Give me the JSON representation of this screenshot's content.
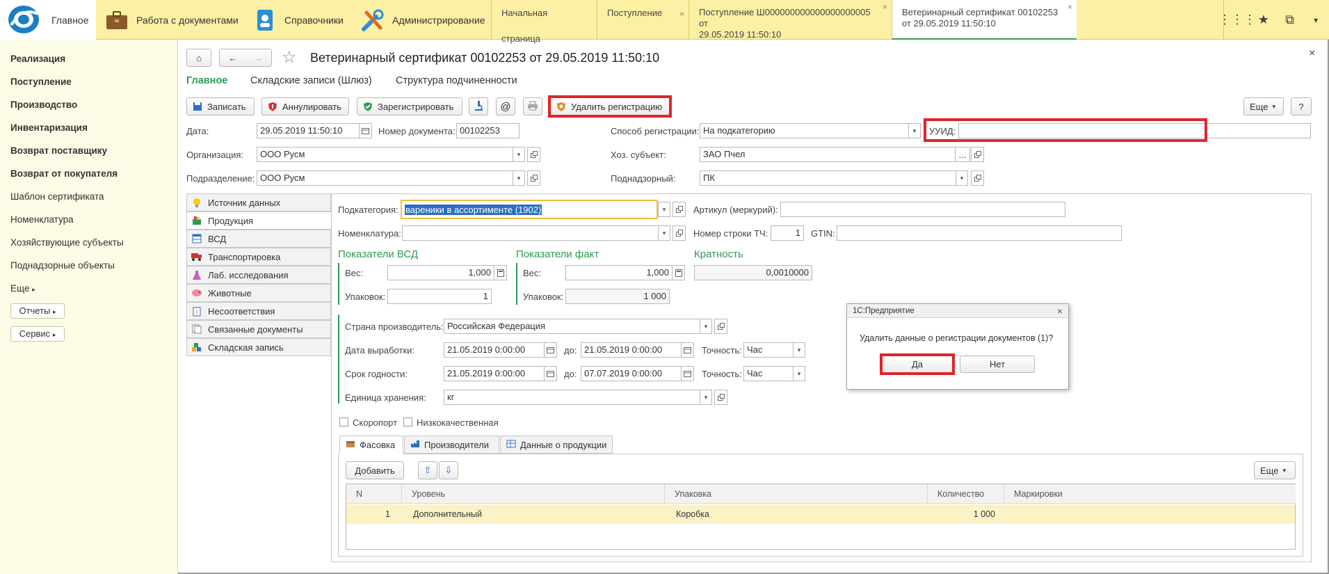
{
  "topbar": {
    "main_label": "Главное",
    "sections": [
      "Работа с документами",
      "Справочники",
      "Администрирование"
    ],
    "tabs": [
      {
        "label": "Начальная страница"
      },
      {
        "label": "Поступление"
      },
      {
        "label1": "Поступление Ш000000000000000000005 от",
        "label2": "29.05.2019 11:50:10"
      },
      {
        "label1": "Ветеринарный сертификат 00102253",
        "label2": "от 29.05.2019 11:50:10"
      }
    ],
    "close_glyph": "×"
  },
  "sidebar": {
    "items_bold": [
      "Реализация",
      "Поступление",
      "Производство",
      "Инвентаризация",
      "Возврат поставщику",
      "Возврат от покупателя"
    ],
    "items": [
      "Шаблон сертификата",
      "Номенклатура",
      "Хозяйствующие субъекты",
      "Поднадзорные объекты"
    ],
    "more": "Еще",
    "reports": "Отчеты",
    "service": "Сервис"
  },
  "doc": {
    "title": "Ветеринарный сертификат 00102253 от 29.05.2019 11:50:10",
    "nav": [
      "Главное",
      "Складские записи (Шлюз)",
      "Структура подчиненности"
    ],
    "toolbar": {
      "save": "Записать",
      "annul": "Аннулировать",
      "register": "Зарегистрировать",
      "at": "@",
      "delete_reg": "Удалить регистрацию",
      "more": "Еще",
      "help": "?"
    }
  },
  "header_fields": {
    "date_label": "Дата:",
    "date_value": "29.05.2019 11:50:10",
    "docnum_label": "Номер документа:",
    "docnum_value": "00102253",
    "reg_method_label": "Способ регистрации:",
    "reg_method_value": "На подкатегорию",
    "uuid_label": "УУИД:",
    "uuid_value": "",
    "org_label": "Организация:",
    "org_value": "ООО Русм",
    "entity_label": "Хоз. субъект:",
    "entity_value": "ЗАО Пчел",
    "entity_dots": "...",
    "dept_label": "Подразделение:",
    "dept_value": "ООО Русм",
    "supervised_label": "Поднадзорный:",
    "supervised_value": "ПК"
  },
  "side_tabs": [
    "Источник данных",
    "Продукция",
    "ВСД",
    "Транспортировка",
    "Лаб. исследования",
    "Животные",
    "Несоответствия",
    "Связанные документы",
    "Складская запись"
  ],
  "product": {
    "subcat_label": "Подкатегория:",
    "subcat_value": "вареники в ассортименте (1902)",
    "article_label": "Артикул (меркурий):",
    "article_value": "",
    "nomen_label": "Номенклатура:",
    "nomen_value": "",
    "rownum_label": "Номер строки ТЧ:",
    "rownum_value": "1",
    "gtin_label": "GTIN:",
    "gtin_value": "",
    "vsd_heading": "Показатели ВСД",
    "fact_heading": "Показатели факт",
    "mult_heading": "Кратность",
    "weight_label": "Вес:",
    "vsd_weight": "1,000",
    "fact_weight": "1,000",
    "mult_value": "0,0010000",
    "pack_label": "Упаковок:",
    "vsd_pack": "1",
    "fact_pack": "1 000",
    "country_label": "Страна производитель:",
    "country_value": "Российская Федерация",
    "prod_date_label": "Дата выработки:",
    "prod_date_from": "21.05.2019  0:00:00",
    "to_label": "до:",
    "prod_date_to": "21.05.2019  0:00:00",
    "precision_label": "Точность:",
    "precision_value": "Час",
    "expiry_label": "Срок годности:",
    "expiry_from": "21.05.2019  0:00:00",
    "expiry_to": "07.07.2019  0:00:00",
    "unit_label": "Единица хранения:",
    "unit_value": "кг",
    "perishable_label": "Скоропорт",
    "lowquality_label": "Низкокачественная"
  },
  "subtabs": [
    "Фасовка",
    "Производители",
    "Данные о продукции"
  ],
  "packing": {
    "add_label": "Добавить",
    "more_label": "Еще",
    "columns": [
      "N",
      "Уровень",
      "Упаковка",
      "Количество",
      "Маркировки"
    ],
    "rows": [
      {
        "n": "1",
        "level": "Дополнительный",
        "pack": "Коробка",
        "qty": "1 000",
        "marks": ""
      }
    ]
  },
  "dialog": {
    "title": "1С:Предприятие",
    "message": "Удалить данные о регистрации документов (1)?",
    "yes": "Да",
    "no": "Нет"
  },
  "colors": {
    "accent_green": "#2e9a53",
    "highlight_red": "#e0242b",
    "topbar_yellow": "#fbf0a3",
    "row_yellow": "#fbf3c6"
  }
}
